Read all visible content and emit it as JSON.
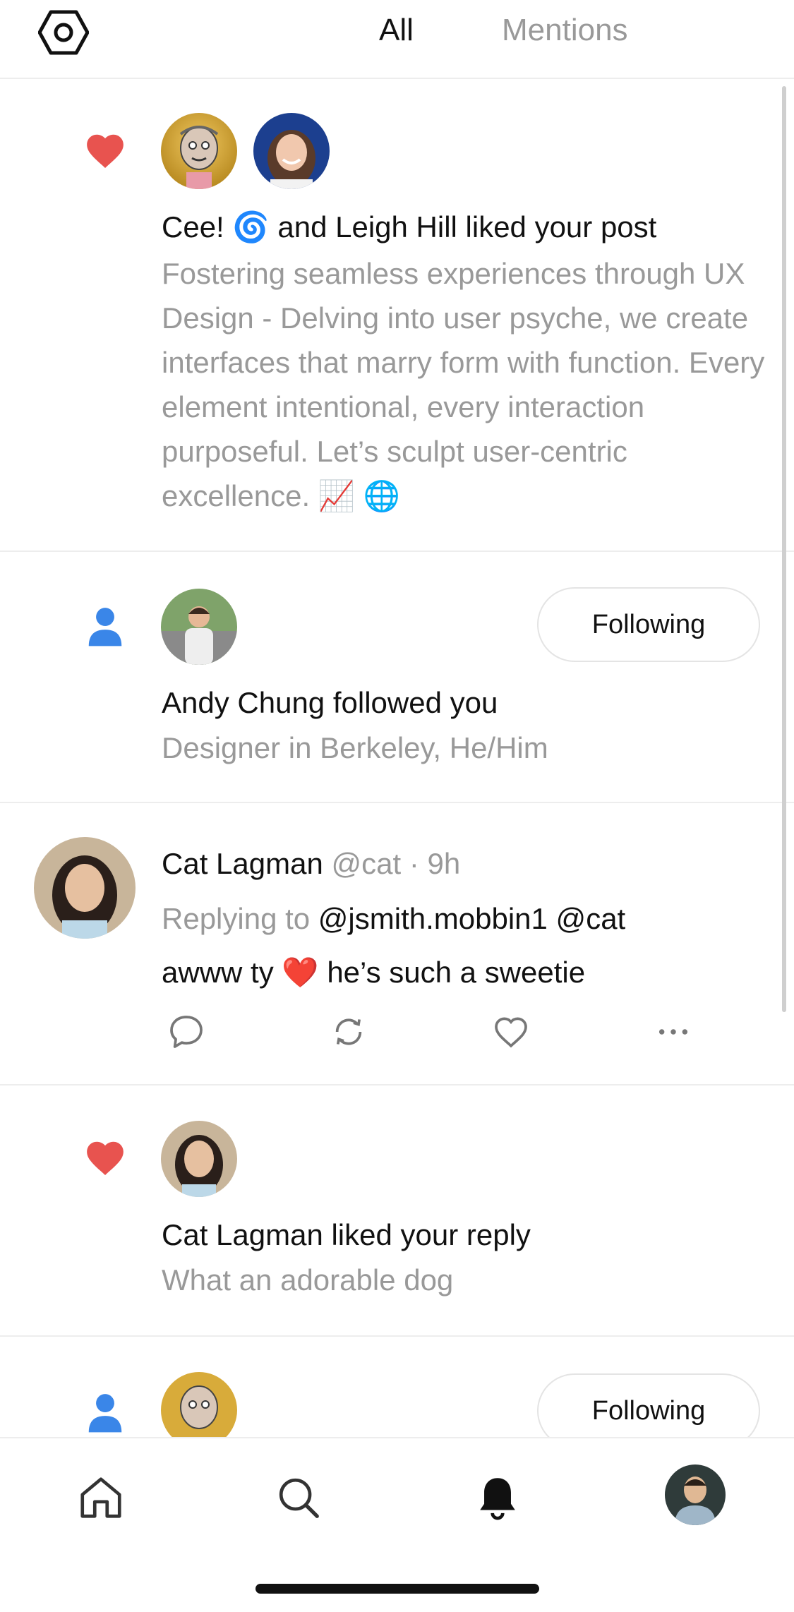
{
  "header": {
    "settings_icon": "hexagon-settings-icon",
    "tabs": [
      {
        "label": "All",
        "active": true
      },
      {
        "label": "Mentions",
        "active": false
      }
    ]
  },
  "feed": [
    {
      "type": "like",
      "icon": "heart-icon",
      "icon_color": "#E8534F",
      "title_prefix": "Cee! ",
      "title_emoji": "🌀",
      "title_suffix": " and Leigh Hill liked your post",
      "description": "Fostering seamless experiences through UX Design - Delving into user psyche, we create interfaces that marry form with function. Every element intentional, every interaction purposeful. Let’s sculpt user-centric excellence.",
      "description_emojis": "📈 🌐"
    },
    {
      "type": "follow",
      "icon": "person-icon",
      "icon_color": "#3A86E8",
      "title": "Andy Chung followed you",
      "description": "Designer in Berkeley, He/Him",
      "button_label": "Following"
    },
    {
      "type": "reply",
      "author": "Cat Lagman",
      "handle": "@cat · 9h",
      "replying_label": "Replying to",
      "replying_to": "@jsmith.mobbin1 @cat",
      "body_prefix": "awww ty ",
      "body_emoji": "❤️",
      "body_suffix": " he’s such a sweetie",
      "actions": [
        "comment-icon",
        "repost-icon",
        "like-icon",
        "more-icon"
      ]
    },
    {
      "type": "like",
      "icon": "heart-icon",
      "icon_color": "#E8534F",
      "title": "Cat Lagman liked your reply",
      "description": "What an adorable dog"
    },
    {
      "type": "follow",
      "icon": "person-icon",
      "icon_color": "#3A86E8",
      "button_label": "Following"
    }
  ],
  "tabbar": {
    "items": [
      {
        "name": "home-icon",
        "active": false
      },
      {
        "name": "search-icon",
        "active": false
      },
      {
        "name": "bell-icon",
        "active": true
      },
      {
        "name": "profile-avatar",
        "active": false
      }
    ]
  }
}
